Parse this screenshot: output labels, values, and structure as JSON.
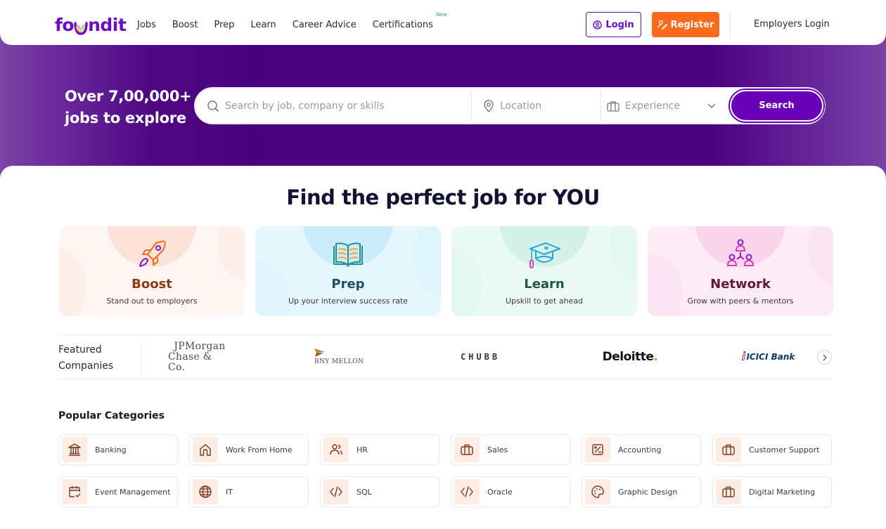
{
  "header": {
    "logo_text_left": "fo",
    "logo_text_right": "ndit",
    "nav": [
      {
        "label": "Jobs"
      },
      {
        "label": "Boost"
      },
      {
        "label": "Prep"
      },
      {
        "label": "Learn"
      },
      {
        "label": "Career Advice"
      },
      {
        "label": "Certifications",
        "badge": "New"
      }
    ],
    "login_label": "Login",
    "register_label": "Register",
    "employers_label": "Employers Login"
  },
  "hero": {
    "headline_line1": "Over 7,00,000+",
    "headline_line2": "jobs to explore",
    "search": {
      "keyword_placeholder": "Search by job, company or skills",
      "location_placeholder": "Location",
      "experience_placeholder": "Experience",
      "button_label": "Search"
    }
  },
  "main": {
    "title": "Find the perfect job for YOU",
    "cards": [
      {
        "title": "Boost",
        "subtitle": "Stand out to employers",
        "icon": "rocket-icon"
      },
      {
        "title": "Prep",
        "subtitle": "Up your interview success rate",
        "icon": "open-book-icon"
      },
      {
        "title": "Learn",
        "subtitle": "Upskill to get ahead",
        "icon": "graduation-cap-icon"
      },
      {
        "title": "Network",
        "subtitle": "Grow with peers & mentors",
        "icon": "people-network-icon"
      }
    ],
    "featured": {
      "label_line1": "Featured",
      "label_line2": "Companies",
      "companies": [
        {
          "name": "JPMorgan Chase & Co.",
          "line1": "JPMorgan",
          "line2": "Chase & Co."
        },
        {
          "name": "BNY Mellon",
          "line1": "BNY MELLON"
        },
        {
          "name": "Chubb",
          "line1": "CHUBB"
        },
        {
          "name": "Deloitte",
          "line1": "Deloitte",
          "suffix": "."
        },
        {
          "name": "ICICI Bank",
          "line1": "ICICI Bank"
        }
      ]
    },
    "popular": {
      "title": "Popular Categories",
      "categories": [
        {
          "label": "Banking",
          "icon": "bank-icon"
        },
        {
          "label": "Work From Home",
          "icon": "home-icon"
        },
        {
          "label": "HR",
          "icon": "users-icon"
        },
        {
          "label": "Sales",
          "icon": "briefcase-icon"
        },
        {
          "label": "Accounting",
          "icon": "calculator-icon"
        },
        {
          "label": "Customer Support",
          "icon": "briefcase-icon"
        },
        {
          "label": "Event Management",
          "icon": "calendar-check-icon"
        },
        {
          "label": "IT",
          "icon": "globe-icon"
        },
        {
          "label": "SQL",
          "icon": "code-icon"
        },
        {
          "label": "Oracle",
          "icon": "code-icon"
        },
        {
          "label": "Graphic Design",
          "icon": "palette-icon"
        },
        {
          "label": "Digital Marketing",
          "icon": "briefcase-icon"
        }
      ]
    }
  },
  "colors": {
    "brand_purple": "#6a0dc7",
    "register_orange": "#fd6a1c",
    "hero_purple": "#4a007d",
    "category_icon_bg": "#fdece4",
    "category_icon_stroke": "#7a3b1e"
  }
}
